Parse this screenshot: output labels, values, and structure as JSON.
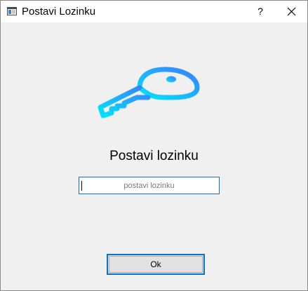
{
  "window": {
    "title": "Postavi Lozinku",
    "help_label": "?"
  },
  "main": {
    "heading": "Postavi lozinku",
    "password_placeholder": "postavi lozinku",
    "password_value": "",
    "ok_label": "Ok"
  },
  "colors": {
    "key_gradient_start": "#00e5ff",
    "key_gradient_end": "#3b7dff",
    "accent_border": "#0a74c4"
  },
  "icons": {
    "app": "window-app-icon",
    "help": "help-icon",
    "close": "close-icon",
    "hero": "key-icon"
  }
}
